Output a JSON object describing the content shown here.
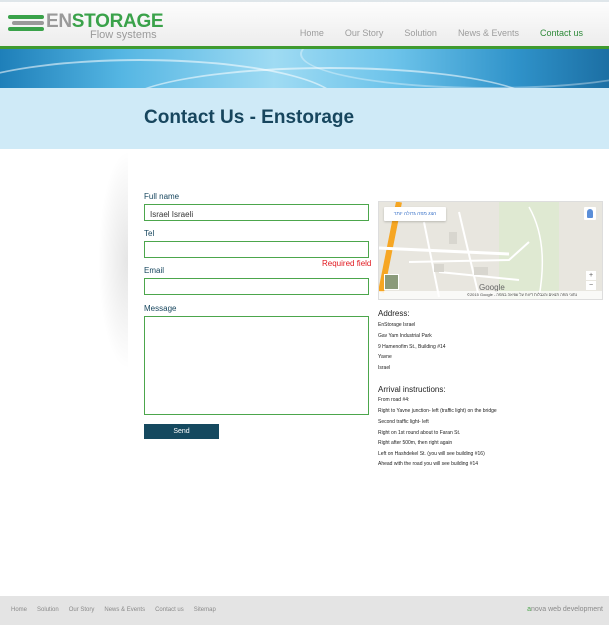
{
  "brand": {
    "wordmark_en": "EN",
    "wordmark_storage": "STORAGE",
    "tagline": "Flow systems"
  },
  "nav": {
    "items": [
      {
        "label": "Home"
      },
      {
        "label": "Our Story"
      },
      {
        "label": "Solution"
      },
      {
        "label": "News & Events"
      },
      {
        "label": "Contact us"
      }
    ],
    "active": "Contact us"
  },
  "page": {
    "title": "Contact Us - Enstorage"
  },
  "form": {
    "full_name": {
      "label": "Full name",
      "value": "Israel Israeli"
    },
    "tel": {
      "label": "Tel",
      "value": ""
    },
    "required_message": "Required field",
    "email": {
      "label": "Email",
      "value": ""
    },
    "message": {
      "label": "Message",
      "value": ""
    },
    "send_label": "Send"
  },
  "map": {
    "enlarge_label": "הצג מפה גדולה יותר",
    "google_label": "Google",
    "zoom_in": "+",
    "zoom_out": "−",
    "attribution": "©2015 Google - נתוני מפה   תנאים והגבלות   דיווח על שגיאה במפה"
  },
  "address": {
    "heading": "Address:",
    "lines": [
      "EnStorage Israel",
      "Gav Yam Industrial Park",
      "9 Hamenofim St., Building #14",
      "Yavne",
      "Israel"
    ]
  },
  "arrival": {
    "heading": "Arrival instructions:",
    "lines": [
      "From road #4:",
      "Right to Yavne junction- left (traffic light) on the bridge",
      "Second traffic light- left",
      "Right on 1st round about to Faran St.",
      "Right after 500m, then right again",
      "Left on Hashdekel St. (you will see building #16)",
      "Ahead with the road you will see building #14"
    ]
  },
  "footer": {
    "links": [
      {
        "label": "Home"
      },
      {
        "label": "Solution"
      },
      {
        "label": "Our Story"
      },
      {
        "label": "News & Events"
      },
      {
        "label": "Contact us"
      },
      {
        "label": "Sitemap"
      }
    ],
    "credit_prefix": "a",
    "credit_rest": "nova web development"
  },
  "colors": {
    "accent_green": "#3aa24a",
    "title_navy": "#17465e",
    "error_red": "#e0171e",
    "band_blue": "#cfeaf7"
  }
}
